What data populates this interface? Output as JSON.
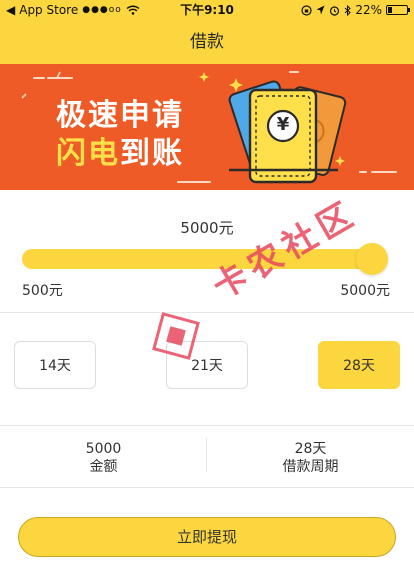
{
  "status_bar": {
    "carrier": "App Store",
    "signal": "●●●oo",
    "time": "下午9:10",
    "battery": "22%",
    "battery_level": 0.22
  },
  "nav": {
    "title": "借款"
  },
  "banner": {
    "line1": "极速申请",
    "line2_part1": "闪电",
    "line2_part2": "到账",
    "ticket_symbol": "¥"
  },
  "loan": {
    "amount_label": "5000元",
    "min_label": "500元",
    "max_label": "5000元",
    "min": 500,
    "max": 5000,
    "value": 5000
  },
  "terms": {
    "options": [
      "14天",
      "21天",
      "28天"
    ],
    "selected_index": 2
  },
  "summary": {
    "amount_value": "5000",
    "amount_label": "金额",
    "period_value": "28天",
    "period_label": "借款周期"
  },
  "submit": {
    "label": "立即提现"
  },
  "watermark": {
    "text": "卡农社区"
  },
  "colors": {
    "accent": "#FCD63E",
    "banner_bg": "#EF5B26"
  }
}
